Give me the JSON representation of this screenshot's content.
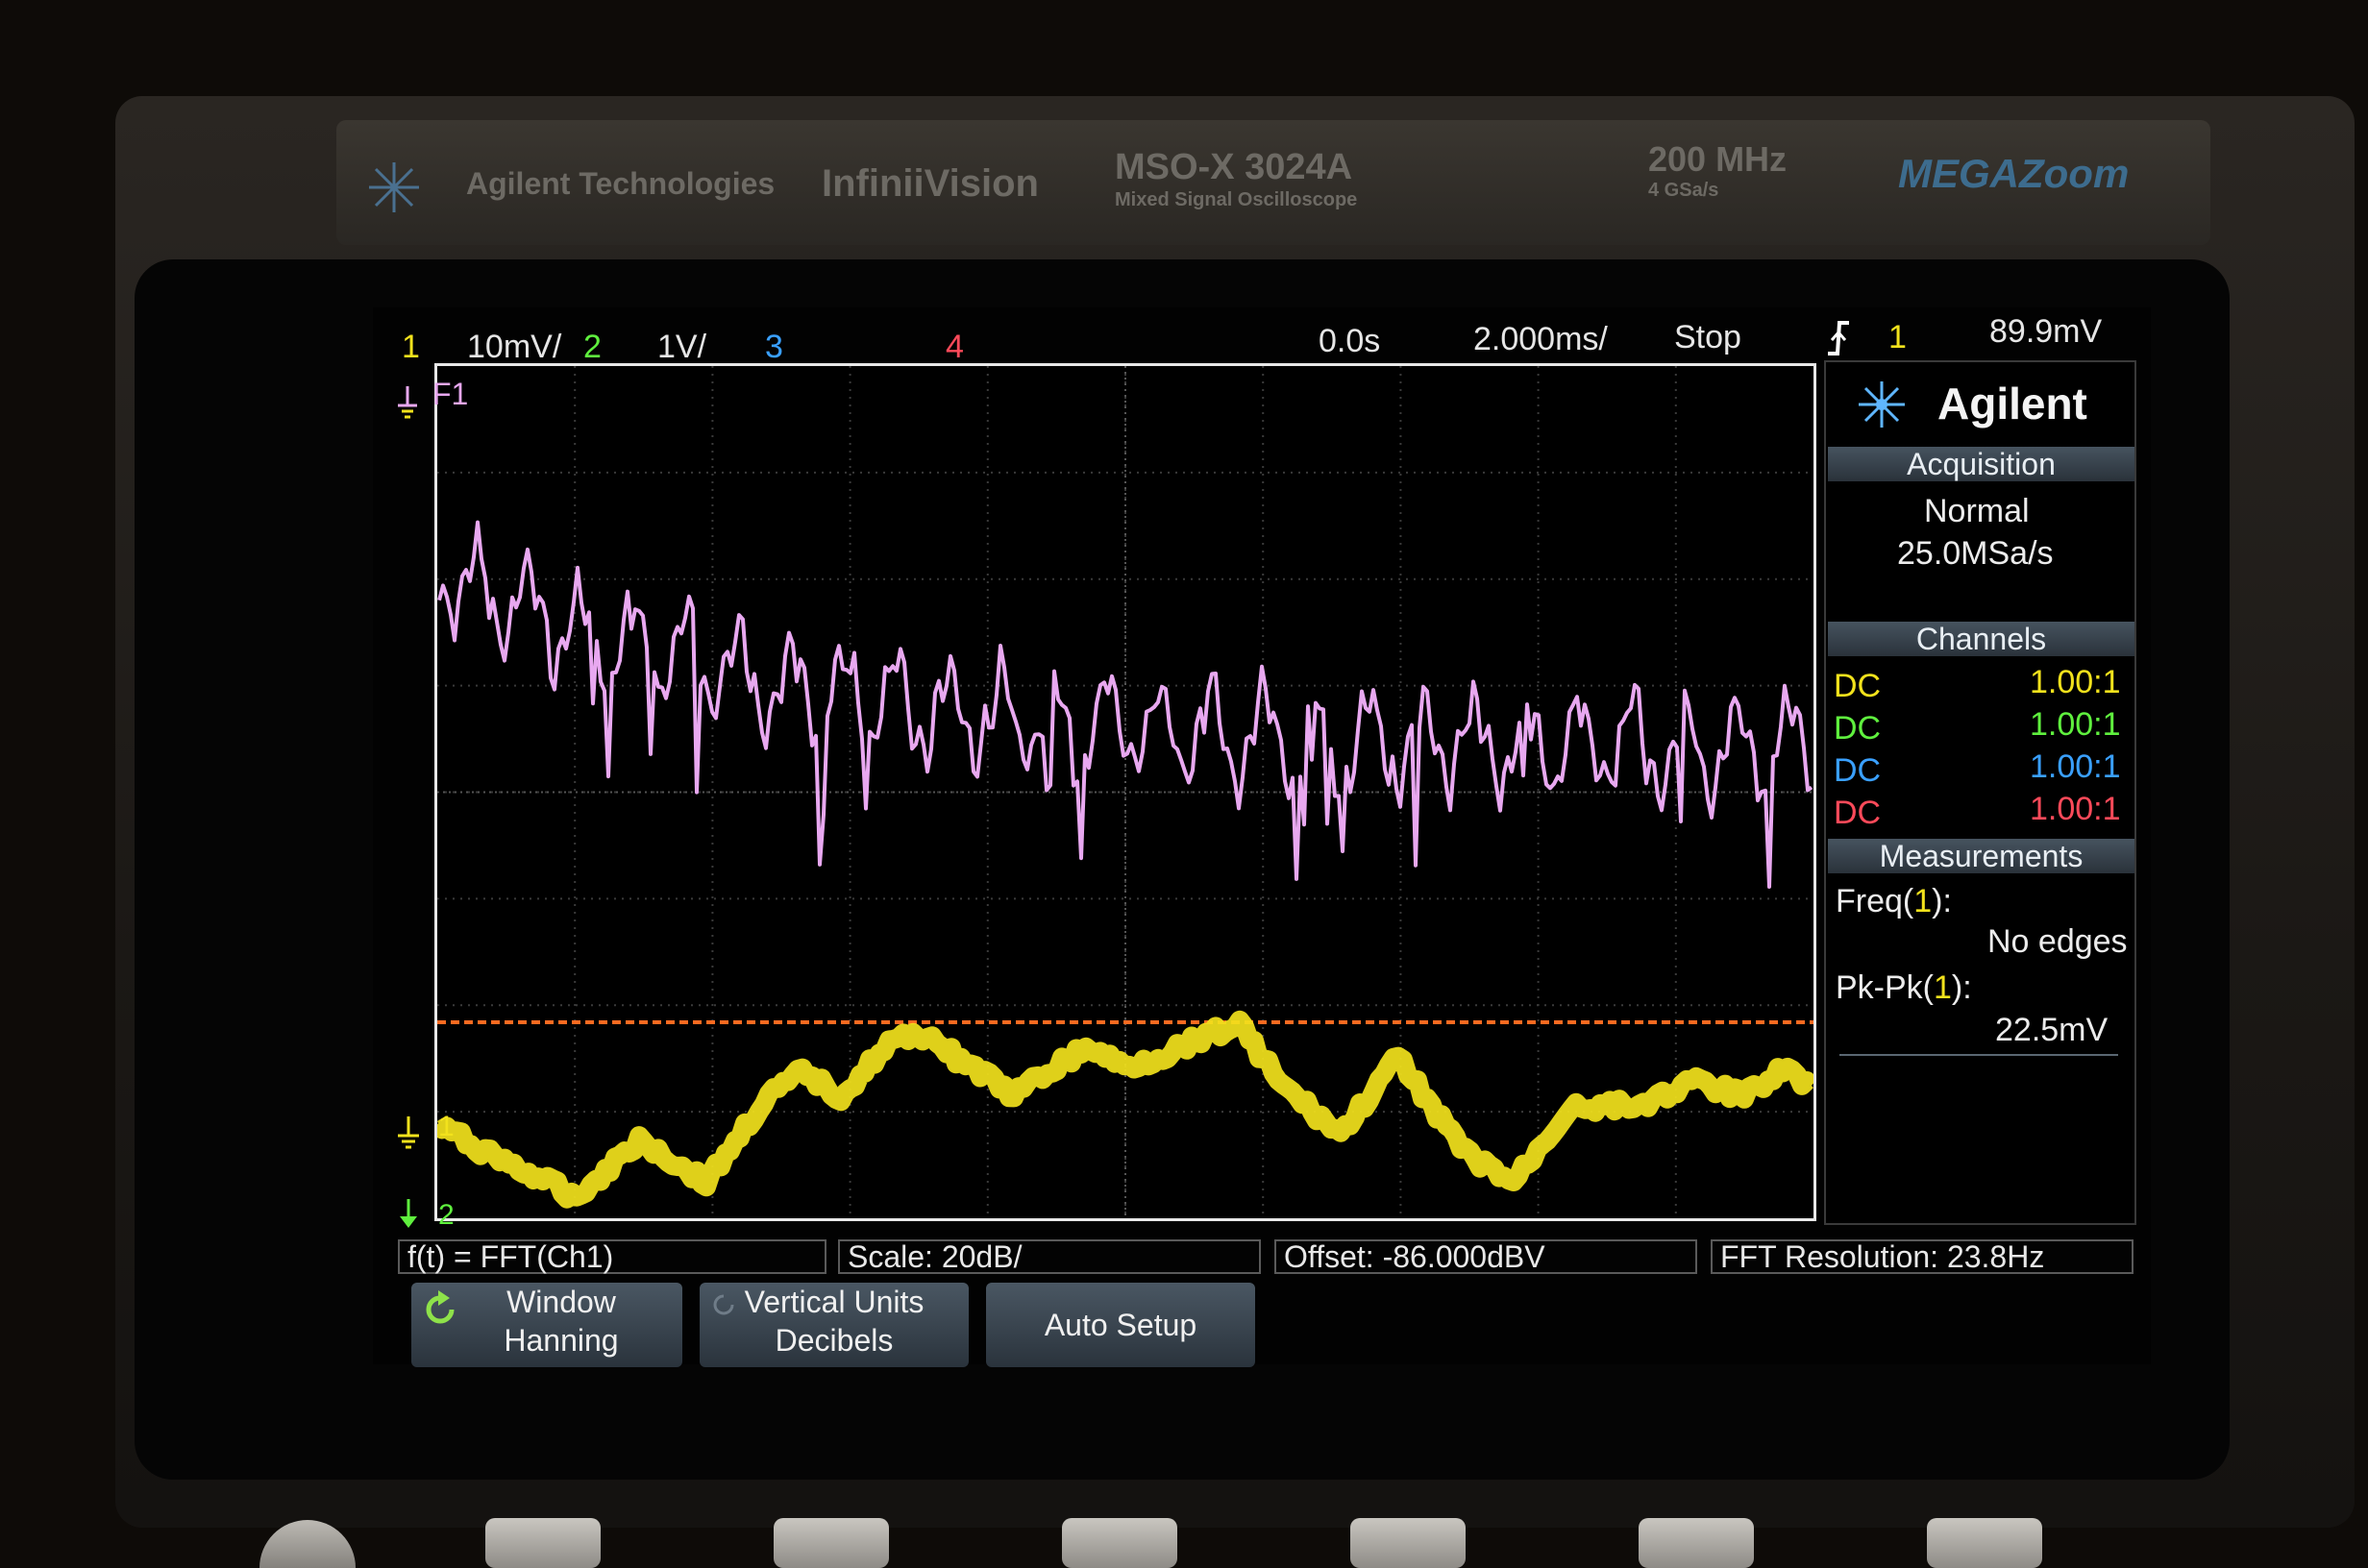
{
  "instrument": {
    "brand": "Agilent Technologies",
    "series": "InfiniiVision",
    "model": "MSO-X 3024A",
    "model_desc": "Mixed Signal Oscilloscope",
    "bandwidth": "200 MHz",
    "sample_rate": "4 GSa/s",
    "zoom_logo": "MEGAZoom"
  },
  "status_bar": {
    "ch1_num": "1",
    "ch1_scale": "10mV/",
    "ch2_num": "2",
    "ch2_scale": "1V/",
    "ch3_num": "3",
    "ch4_num": "4",
    "time_delay": "0.0s",
    "time_scale": "2.000ms/",
    "run_state": "Stop",
    "trigger_source": "1",
    "trigger_level": "89.9mV"
  },
  "markers": {
    "math": "F1",
    "ch1": "1",
    "ch2": "2"
  },
  "side_panel": {
    "logo": "Agilent",
    "acquisition_title": "Acquisition",
    "acq_mode": "Normal",
    "acq_rate": "25.0MSa/s",
    "channels_title": "Channels",
    "channels": [
      {
        "coupling": "DC",
        "probe": "1.00:1",
        "color": "#f2e21c"
      },
      {
        "coupling": "DC",
        "probe": "1.00:1",
        "color": "#5ff03e"
      },
      {
        "coupling": "DC",
        "probe": "1.00:1",
        "color": "#3aa0ff"
      },
      {
        "coupling": "DC",
        "probe": "1.00:1",
        "color": "#ff4a5a"
      }
    ],
    "measurements_title": "Measurements",
    "meas1_name": "Freq(",
    "meas1_ch": "1",
    "meas1_close": "):",
    "meas1_value": "No edges",
    "meas2_name": "Pk-Pk(",
    "meas2_ch": "1",
    "meas2_close": "):",
    "meas2_value": "22.5mV"
  },
  "info_line": {
    "function": "f(t) = FFT(Ch1)",
    "scale": "Scale: 20dB/",
    "offset": "Offset: -86.000dBV",
    "resolution": "FFT Resolution: 23.8Hz"
  },
  "softkeys": {
    "window_title": "Window",
    "window_value": "Hanning",
    "units_title": "Vertical Units",
    "units_value": "Decibels",
    "auto_setup": "Auto Setup"
  },
  "colors": {
    "ch1": "#f2e21c",
    "ch2": "#5ff03e",
    "ch3": "#3aa0ff",
    "ch4": "#ff4a5a",
    "math": "#e8a8f0",
    "trigger_line": "#ff6a20"
  }
}
